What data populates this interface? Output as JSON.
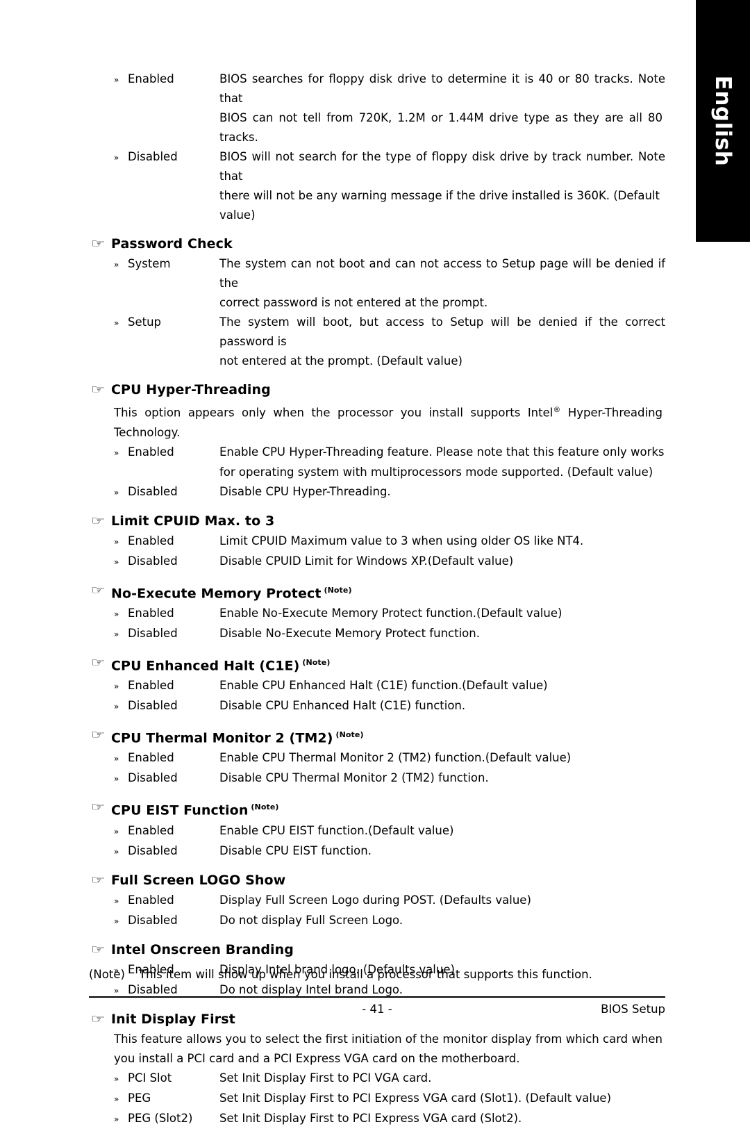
{
  "side_tab": {
    "label": "English"
  },
  "icons": {
    "hand": "☞",
    "chevron": "»"
  },
  "top_block": {
    "rows": [
      {
        "bullet": "»",
        "label": "Enabled",
        "desc": "BIOS searches for floppy disk drive to determine it is 40 or 80 tracks. Note that",
        "cont": "BIOS can not tell from 720K, 1.2M or 1.44M drive type as they are all 80 tracks."
      },
      {
        "bullet": "»",
        "label": "Disabled",
        "desc": "BIOS will not search for the type of floppy disk drive by track number. Note that",
        "cont": "there will not be any warning message if the drive installed is 360K. (Default",
        "cont2": "value)"
      }
    ]
  },
  "sections": [
    {
      "title": "Password Check",
      "note": false,
      "para": null,
      "rows": [
        {
          "label": "System",
          "desc": "The system can not boot and can not access to Setup page will be denied if the",
          "cont": "correct password is not entered at the prompt."
        },
        {
          "label": "Setup",
          "desc": "The system will boot, but access to Setup will be denied if the correct password is",
          "cont": "not entered at the prompt. (Default value)"
        }
      ]
    },
    {
      "title": "CPU Hyper-Threading",
      "note": false,
      "para": "This option appears only when the processor you install supports Intel® Hyper-Threading Technology.",
      "rows": [
        {
          "label": "Enabled",
          "desc": "Enable CPU Hyper-Threading feature. Please note that this feature only works",
          "cont": "for operating system with multiprocessors mode supported. (Default value)"
        },
        {
          "label": "Disabled",
          "desc": "Disable CPU Hyper-Threading.",
          "cont": null
        }
      ]
    },
    {
      "title": "Limit CPUID Max. to 3",
      "note": false,
      "para": null,
      "rows": [
        {
          "label": "Enabled",
          "desc": "Limit CPUID Maximum value to 3 when using older OS like NT4.",
          "cont": null
        },
        {
          "label": "Disabled",
          "desc": "Disable CPUID Limit for Windows XP.(Default value)",
          "cont": null
        }
      ]
    },
    {
      "title": "No-Execute Memory Protect",
      "note": true,
      "para": null,
      "rows": [
        {
          "label": "Enabled",
          "desc": "Enable No-Execute Memory Protect function.(Default value)",
          "cont": null
        },
        {
          "label": "Disabled",
          "desc": "Disable No-Execute Memory Protect function.",
          "cont": null
        }
      ]
    },
    {
      "title": "CPU Enhanced Halt (C1E)",
      "note": true,
      "para": null,
      "rows": [
        {
          "label": "Enabled",
          "desc": "Enable CPU Enhanced Halt (C1E) function.(Default value)",
          "cont": null
        },
        {
          "label": "Disabled",
          "desc": "Disable CPU Enhanced Halt (C1E) function.",
          "cont": null
        }
      ]
    },
    {
      "title": "CPU Thermal Monitor 2 (TM2)",
      "note": true,
      "para": null,
      "rows": [
        {
          "label": "Enabled",
          "desc": "Enable CPU Thermal Monitor 2 (TM2) function.(Default value)",
          "cont": null
        },
        {
          "label": "Disabled",
          "desc": "Disable CPU Thermal Monitor 2 (TM2) function.",
          "cont": null
        }
      ]
    },
    {
      "title": "CPU EIST Function",
      "note": true,
      "para": null,
      "rows": [
        {
          "label": "Enabled",
          "desc": "Enable CPU EIST function.(Default value)",
          "cont": null
        },
        {
          "label": "Disabled",
          "desc": "Disable CPU EIST function.",
          "cont": null
        }
      ]
    },
    {
      "title": "Full Screen LOGO Show",
      "note": false,
      "para": null,
      "rows": [
        {
          "label": "Enabled",
          "desc": "Display Full Screen Logo during POST. (Defaults value)",
          "cont": null
        },
        {
          "label": "Disabled",
          "desc": "Do not display Full Screen Logo.",
          "cont": null
        }
      ]
    },
    {
      "title": "Intel Onscreen Branding",
      "note": false,
      "para": null,
      "rows": [
        {
          "label": "Enabled",
          "desc": "Display Intel brand logo. (Defaults value)",
          "cont": null
        },
        {
          "label": "Disabled",
          "desc": "Do not display Intel brand Logo.",
          "cont": null
        }
      ]
    },
    {
      "title": "Init Display First",
      "note": false,
      "para": "This feature allows you to select the first initiation of the monitor display from which card when you install a PCI card and a PCI Express VGA card on the motherboard.",
      "rows": [
        {
          "label": "PCI Slot",
          "desc": "Set Init Display First to PCI VGA card.",
          "cont": null
        },
        {
          "label": "PEG",
          "desc": "Set Init Display First to PCI Express VGA card (Slot1). (Default value)",
          "cont": null
        },
        {
          "label": "PEG (Slot2)",
          "desc": "Set Init Display First to PCI Express VGA card (Slot2).",
          "cont": null
        }
      ]
    }
  ],
  "footnote": {
    "label": "(Note)",
    "text": "This item will show up when you install a processor that supports this function."
  },
  "footer": {
    "page": "- 41 -",
    "right": "BIOS Setup"
  }
}
